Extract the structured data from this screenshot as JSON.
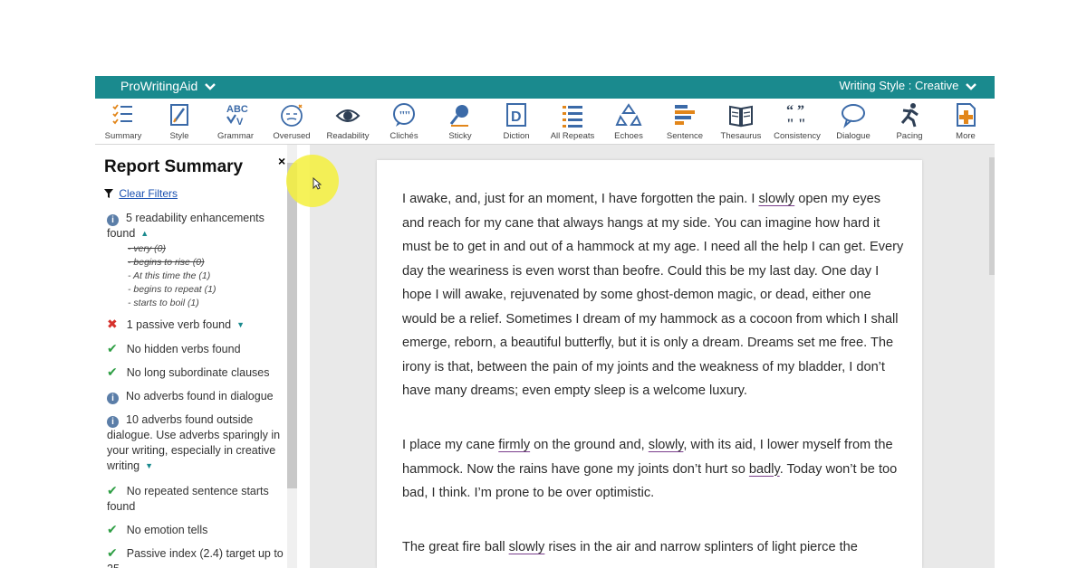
{
  "topbar": {
    "brand": "ProWritingAid",
    "style_select": "Writing Style : Creative",
    "color": "#1a8a8e"
  },
  "toolbar": {
    "items": [
      {
        "label": "Summary",
        "icon": "summary-icon"
      },
      {
        "label": "Style",
        "icon": "style-icon"
      },
      {
        "label": "Grammar",
        "icon": "grammar-icon"
      },
      {
        "label": "Overused",
        "icon": "overused-icon"
      },
      {
        "label": "Readability",
        "icon": "readability-eye-icon"
      },
      {
        "label": "Clichés",
        "icon": "cliches-quote-bubble-icon"
      },
      {
        "label": "Sticky",
        "icon": "sticky-icon"
      },
      {
        "label": "Diction",
        "icon": "diction-icon"
      },
      {
        "label": "All Repeats",
        "icon": "all-repeats-list-icon"
      },
      {
        "label": "Echoes",
        "icon": "echoes-recycle-icon"
      },
      {
        "label": "Sentence",
        "icon": "sentence-bars-icon"
      },
      {
        "label": "Thesaurus",
        "icon": "thesaurus-book-icon"
      },
      {
        "label": "Consistency",
        "icon": "consistency-quotes-icon"
      },
      {
        "label": "Dialogue",
        "icon": "dialogue-bubble-icon"
      },
      {
        "label": "Pacing",
        "icon": "pacing-runner-icon"
      },
      {
        "label": "More",
        "icon": "more-plus-icon"
      }
    ]
  },
  "sidebar": {
    "title": "Report Summary",
    "close": "×",
    "clear_filters": "Clear Filters",
    "items": [
      {
        "icon": "info",
        "text": "5 readability enhancements found"
      },
      {
        "icon": "cross",
        "text": "1 passive verb found"
      },
      {
        "icon": "check",
        "text": "No hidden verbs found"
      },
      {
        "icon": "check",
        "text": "No long subordinate clauses"
      },
      {
        "icon": "info",
        "text": "No adverbs found in dialogue"
      },
      {
        "icon": "info",
        "text": "10 adverbs found outside dialogue. Use adverbs sparingly in your writing, especially in creative writing"
      },
      {
        "icon": "check",
        "text": "No repeated sentence starts found"
      },
      {
        "icon": "check",
        "text": "No emotion tells"
      },
      {
        "icon": "check",
        "text": "Passive index (2.4) target up to 25"
      }
    ],
    "sub_items": [
      {
        "text": "- very (0)",
        "struck": true
      },
      {
        "text": "- begins to rise (0)",
        "struck": true
      },
      {
        "text": "- At this time the (1)",
        "struck": false
      },
      {
        "text": "- begins to repeat (1)",
        "struck": false
      },
      {
        "text": "- starts to boil (1)",
        "struck": false
      }
    ]
  },
  "editor": {
    "p1": {
      "a": "I awake, and, just for an moment, I have forgotten the pain. I ",
      "u1": "slowly",
      "b": " open my eyes and reach for my cane that always hangs at my side. You can imagine how hard it must be to get in and out of a hammock at my age. I need all the help I can get. Every day the weariness is even worst than beofre. Could this be my last day. One day I hope I will awake, rejuvenated by some ghost-demon magic, or dead, either one would be a relief. Sometimes I dream of my hammock as a cocoon from which I shall emerge, reborn, a beautiful butterfly, but it is only a dream. Dreams set me free. The irony is that, between the pain of my joints and the weakness of my bladder, I don’t have many dreams; even empty sleep is a welcome luxury."
    },
    "p2": {
      "a": "I place my cane ",
      "u1": "firmly",
      "b": " on the ground and, ",
      "u2": "slowly",
      "c": ", with its aid, I lower myself from the hammock. Now the rains have gone my joints don’t hurt so ",
      "u3": "badly",
      "d": ". Today won’t be too bad, I think. I’m prone to be over optimistic."
    },
    "p3": {
      "a": "The great fire ball ",
      "u1": "slowly",
      "b": " rises in the air and narrow splinters of light pierce the"
    }
  }
}
